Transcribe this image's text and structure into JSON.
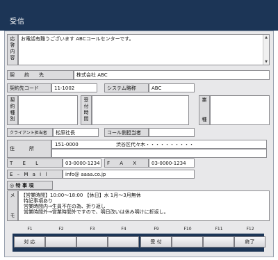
{
  "window": {
    "title": "受信"
  },
  "script_label": [
    "応",
    "答",
    "内",
    "容"
  ],
  "script_text": "お電話有難うございます ABCコールセンターです。",
  "contract": {
    "label": "契　　約　　先",
    "value": "株式会社 ABC"
  },
  "contract_code": {
    "label": "契約先コード",
    "value": "11-1002"
  },
  "system_abbr": {
    "label": "システム略称",
    "value": "ABC"
  },
  "contract_type": {
    "label": [
      "契",
      "約",
      "種",
      "別"
    ]
  },
  "reception_time": {
    "label": [
      "受",
      "付",
      "時",
      "間"
    ]
  },
  "business_type": {
    "label_top": "業",
    "label_bottom": "種"
  },
  "client_person": {
    "label": "クライアント担当者",
    "value": "松原社長"
  },
  "call_person": {
    "label": "コール側担当者",
    "value": ""
  },
  "address": {
    "label": "住　　　所",
    "zip": "151-0000",
    "line1": "渋谷区代々木・・・・・・・・・・",
    "line2": ""
  },
  "tel": {
    "label": "T E L",
    "value": "03-0000-1234"
  },
  "fax": {
    "label": "F A X",
    "value": "03-0000-1234"
  },
  "email": {
    "label": "E – M a i l",
    "value": "info@ aaaa.co.jp"
  },
  "notes_label": "◎ 特 事 項",
  "memo": {
    "label_top": "メ",
    "label_bottom": "モ",
    "lines": [
      "【営業時間】10:00～18:00 【休日】水 1月～3月無休",
      "特記事項あり",
      "営業時間内→生員不在の為、折り返し",
      "営業時間外→営業時間外ですので、明日改いは休み明けに折返し。"
    ]
  },
  "fkeys": [
    {
      "key": "F1",
      "label": "対 応"
    },
    {
      "key": "F2",
      "label": ""
    },
    {
      "key": "F3",
      "label": ""
    },
    {
      "key": "F4",
      "label": ""
    },
    {
      "key": "F9",
      "label": "受 付"
    },
    {
      "key": "F10",
      "label": ""
    },
    {
      "key": "F11",
      "label": ""
    },
    {
      "key": "F12",
      "label": "終了"
    }
  ]
}
